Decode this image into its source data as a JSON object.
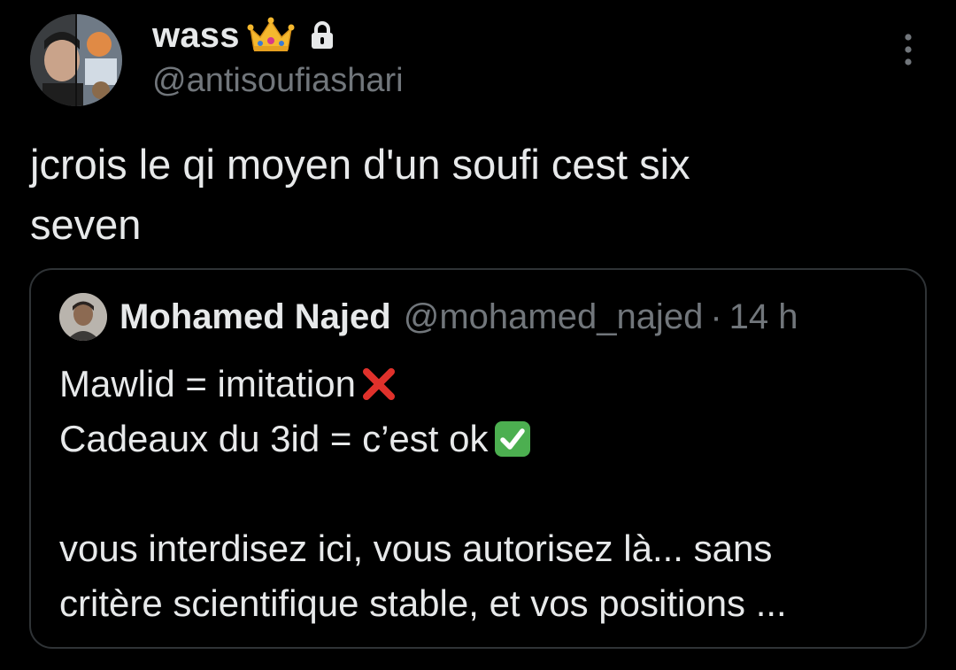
{
  "author": {
    "display_name": "wass",
    "handle": "@antisoufiashari",
    "badges": [
      "crown-emoji-icon",
      "lock-icon"
    ]
  },
  "menu": {
    "icon": "more-vertical-icon"
  },
  "tweet": {
    "lines": [
      "jcrois le qi moyen d'un soufi cest six",
      "seven"
    ]
  },
  "quoted_tweet": {
    "author": {
      "display_name": "Mohamed Najed",
      "handle": "@mohamed_najed",
      "separator": "·",
      "time": "14 h"
    },
    "lines": [
      {
        "text": "Mawlid = imitation",
        "emoji": "cross-mark-icon"
      },
      {
        "text": "Cadeaux du 3id = c’est ok",
        "emoji": "check-mark-button-icon"
      },
      {
        "text": ""
      },
      {
        "text": "vous interdisez ici, vous autorisez là... sans"
      },
      {
        "text": "critère scientifique stable, et vos positions ..."
      }
    ]
  },
  "colors": {
    "background": "#000000",
    "primary_text": "#e7e9ea",
    "secondary_text": "#71767b",
    "border": "#2f3336",
    "cross": "#e0312b",
    "check": "#4caf50"
  }
}
